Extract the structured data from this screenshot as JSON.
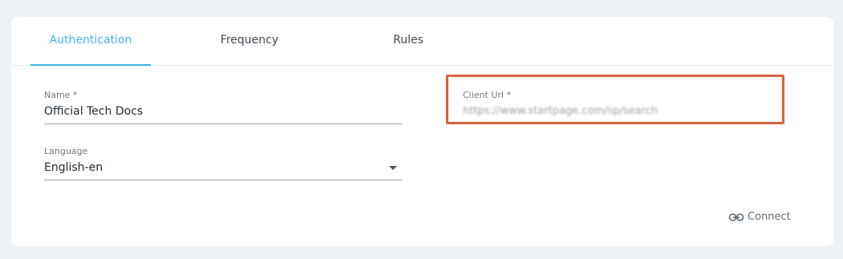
{
  "tabs": [
    {
      "label": "Authentication",
      "active": true
    },
    {
      "label": "Frequency",
      "active": false
    },
    {
      "label": "Rules",
      "active": false
    }
  ],
  "form": {
    "name": {
      "label": "Name *",
      "value": "Official Tech Docs"
    },
    "language": {
      "label": "Language",
      "value": "English-en"
    },
    "client_url": {
      "label": "Client Url *",
      "value": "https://www.startpage.com/sp/search"
    }
  },
  "actions": {
    "connect_label": "Connect",
    "connect_icon": "link-icon"
  },
  "colors": {
    "accent": "#3fb4e6",
    "highlight": "#d9613f",
    "background": "#eef2f4"
  }
}
